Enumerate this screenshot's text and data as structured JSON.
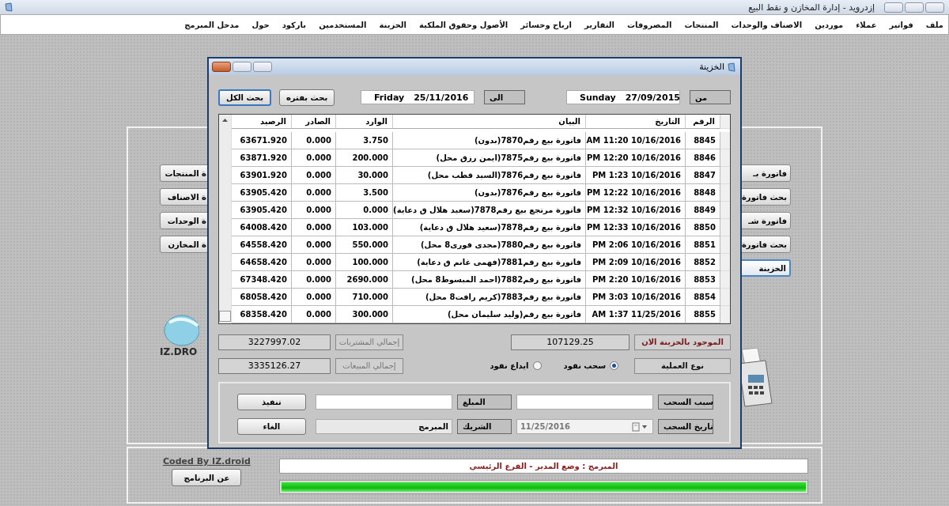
{
  "window": {
    "title": "إزدرويد - إدارة المخازن و نقط البيع"
  },
  "menu": [
    "ملف",
    "فواتير",
    "عملاء",
    "موردين",
    "الاصناف والوحدات",
    "المنتجات",
    "المصروفات",
    "التقارير",
    "ارباح وخسائر",
    "الأصول وحقوق الملكية",
    "الخزينة",
    "المستخدمين",
    "باركود",
    "حول",
    "مدخل المبرمج"
  ],
  "left_buttons": [
    "ة المنتجات",
    "ة الاصناف",
    "ة الوحدات",
    "ة المخازن"
  ],
  "right_buttons": [
    {
      "label": "فاتورة بـ",
      "focused": false
    },
    {
      "label": "بحث فاتورة",
      "focused": false
    },
    {
      "label": "فاتورة شـ",
      "focused": false
    },
    {
      "label": "بحث فاتورة",
      "focused": false
    },
    {
      "label": "الخزينة",
      "focused": true
    }
  ],
  "logo_text": "IZ.DRO",
  "footer": {
    "credit": "Coded By IZ.droid",
    "about_button": "عن البرنامج",
    "status": "المبرمج : وضع المدير - الفرع الرئيسي",
    "level": 1
  },
  "dialog": {
    "title": "الخزينة",
    "filter": {
      "from_label": "من",
      "from_day": "Sunday",
      "from_date": "27/09/2015",
      "to_label": "الى",
      "to_day": "Friday",
      "to_date": "25/11/2016",
      "period_button": "بحث بفتره",
      "all_button": "بحث الكل"
    },
    "table": {
      "columns": [
        "الرقم",
        "التاريخ",
        "البيان",
        "الوارد",
        "الصادر",
        "الرصيد"
      ],
      "rows": [
        [
          "8845",
          "AM 11:20 10/16/2016",
          "فاتورة بيع رقم7870(بدون)",
          "3.750",
          "0.000",
          "63671.920"
        ],
        [
          "8846",
          "PM 12:20 10/16/2016",
          "فاتورة بيع رقم7875(ايمن رزق محل)",
          "200.000",
          "0.000",
          "63871.920"
        ],
        [
          "8847",
          "PM 1:23 10/16/2016",
          "فاتورة بيع رقم7876(السيد قطب محل)",
          "30.000",
          "0.000",
          "63901.920"
        ],
        [
          "8848",
          "PM 12:22 10/16/2016",
          "فاتورة بيع رقم7876(بدون)",
          "3.500",
          "0.000",
          "63905.420"
        ],
        [
          "8849",
          "PM 12:32 10/16/2016",
          "فاتورة مرتجع بيع رقم7878(سعيد هلال    ق دعاية)",
          "0.000",
          "0.000",
          "63905.420"
        ],
        [
          "8850",
          "PM 12:33 10/16/2016",
          "فاتورة بيع رقم7878(سعيد هلال    ق دعاية)",
          "103.000",
          "0.000",
          "64008.420"
        ],
        [
          "8851",
          "PM 2:06 10/16/2016",
          "فاتورة بيع رقم7880(مجدى فورى8 محل)",
          "550.000",
          "0.000",
          "64558.420"
        ],
        [
          "8852",
          "PM 2:09 10/16/2016",
          "فاتورة بيع رقم7881(فهمى غانم    ق دعاية)",
          "100.000",
          "0.000",
          "64658.420"
        ],
        [
          "8853",
          "PM 2:20 10/16/2016",
          "فاتورة بيع رقم7882(احمد المبسوط8 محل)",
          "2690.000",
          "0.000",
          "67348.420"
        ],
        [
          "8854",
          "PM 3:03 10/16/2016",
          "فاتورة بيع رقم7883(كريم رافت8 محل)",
          "710.000",
          "0.000",
          "68058.420"
        ],
        [
          "8855",
          "AM 1:37 11/25/2016",
          "فاتورة بيع رقم(وليد سليمان محل)",
          "300.000",
          "0.000",
          "68358.420"
        ]
      ]
    },
    "totals": {
      "balance_label": "الموجود بالخزينة الان",
      "balance": "107129.25",
      "purchases_label": "إجمالي المشتريات",
      "purchases": "3227997.02",
      "sales_label": "إجمالي المبيعات",
      "sales": "3335126.27"
    },
    "operation": {
      "label": "نوع العملية",
      "options": [
        {
          "label": "سحب نقود",
          "selected": true
        },
        {
          "label": "ايداع نقود",
          "selected": false
        }
      ]
    },
    "form": {
      "reason_label": "سبب السحب",
      "amount_label": "المبلغ",
      "execute_button": "تنفيذ",
      "date_label": "تاريخ السحب",
      "date": "11/25/2016",
      "partner_label": "الشريك",
      "partner": "المبرمج",
      "cancel_button": "الغاء"
    }
  }
}
